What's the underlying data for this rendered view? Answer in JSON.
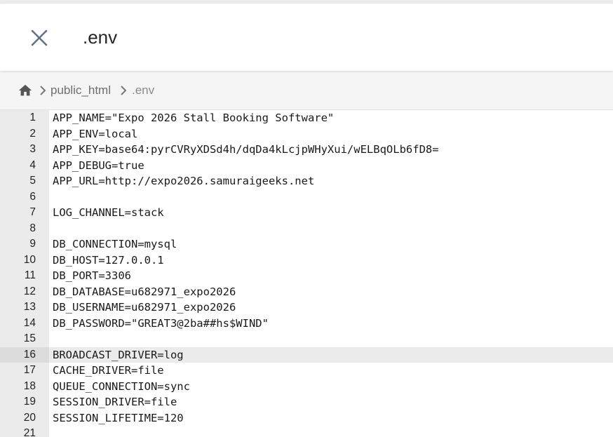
{
  "header": {
    "title": ".env",
    "close_icon": "close-icon"
  },
  "breadcrumb": {
    "home_icon": "home-icon",
    "separator_icon": "chevron-right-icon",
    "folder": "public_html",
    "current": ".env"
  },
  "editor": {
    "active_line": 16,
    "lines": [
      {
        "num": "1",
        "text": "APP_NAME=\"Expo 2026 Stall Booking Software\""
      },
      {
        "num": "2",
        "text": "APP_ENV=local"
      },
      {
        "num": "3",
        "text": "APP_KEY=base64:pyrCVRyXDSd4h/dqDa4kLcjpWHyXui/wELBqOLb6fD8="
      },
      {
        "num": "4",
        "text": "APP_DEBUG=true"
      },
      {
        "num": "5",
        "text": "APP_URL=http://expo2026.samuraigeeks.net"
      },
      {
        "num": "6",
        "text": ""
      },
      {
        "num": "7",
        "text": "LOG_CHANNEL=stack"
      },
      {
        "num": "8",
        "text": ""
      },
      {
        "num": "9",
        "text": "DB_CONNECTION=mysql"
      },
      {
        "num": "10",
        "text": "DB_HOST=127.0.0.1"
      },
      {
        "num": "11",
        "text": "DB_PORT=3306"
      },
      {
        "num": "12",
        "text": "DB_DATABASE=u682971_expo2026"
      },
      {
        "num": "13",
        "text": "DB_USERNAME=u682971_expo2026"
      },
      {
        "num": "14",
        "text": "DB_PASSWORD=\"GREAT3@2ba##hs$WIND\""
      },
      {
        "num": "15",
        "text": ""
      },
      {
        "num": "16",
        "text": "BROADCAST_DRIVER=log"
      },
      {
        "num": "17",
        "text": "CACHE_DRIVER=file"
      },
      {
        "num": "18",
        "text": "QUEUE_CONNECTION=sync"
      },
      {
        "num": "19",
        "text": "SESSION_DRIVER=file"
      },
      {
        "num": "20",
        "text": "SESSION_LIFETIME=120"
      },
      {
        "num": "21",
        "text": ""
      }
    ]
  }
}
